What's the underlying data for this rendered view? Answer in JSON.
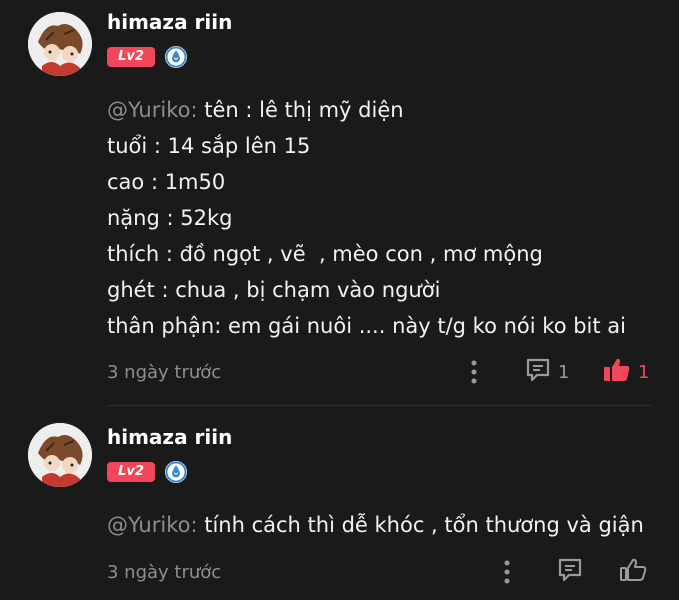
{
  "comments": [
    {
      "username": "himaza riin",
      "level": "Lv2",
      "mention": "@Yuriko:",
      "lines": [
        " tên : lê thị mỹ diện",
        "tuổi : 14 sắp lên 15",
        "cao : 1m50",
        "nặng : 52kg",
        "thích : đồ ngọt , vẽ  , mèo con , mơ mộng",
        "ghét : chua , bị chạm vào người",
        "thân phận: em gái nuôi .... này t/g ko nói ko bit ai"
      ],
      "time": "3 ngày trước",
      "reply_count": "1",
      "like_count": "1",
      "liked": true
    },
    {
      "username": "himaza riin",
      "level": "Lv2",
      "mention": "@Yuriko:",
      "lines": [
        " tính cách thì dễ khóc , tổn thương và giận"
      ],
      "time": "3 ngày trước",
      "reply_count": "",
      "like_count": "",
      "liked": false
    }
  ],
  "colors": {
    "accent": "#f0485a",
    "role_icon": "#3d8bd6",
    "background": "#1a1a1a",
    "muted_text": "#8e8e8e"
  },
  "icons": {
    "role": "droplet-badge-icon",
    "more": "more-vertical-icon",
    "reply": "comment-icon",
    "like": "thumbs-up-icon"
  }
}
